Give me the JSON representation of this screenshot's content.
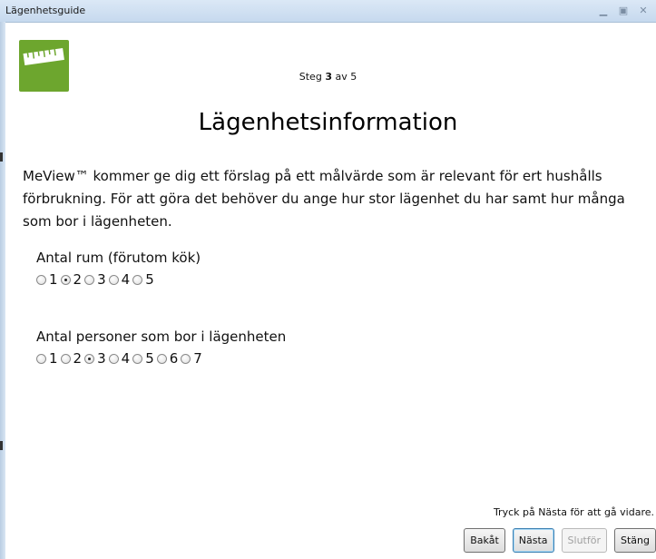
{
  "window": {
    "title": "Lägenhetsguide"
  },
  "step": {
    "prefix": "Steg ",
    "current": "3",
    "suffix": " av 5"
  },
  "heading": "Lägenhetsinformation",
  "intro": "MeView™ kommer ge dig ett förslag på ett målvärde som är relevant för ert hushålls förbrukning. För att göra det behöver du ange hur stor lägenhet du har samt hur många som bor i lägenheten.",
  "rooms": {
    "label": "Antal rum (förutom kök)",
    "options": [
      "1",
      "2",
      "3",
      "4",
      "5"
    ],
    "selected": "2"
  },
  "persons": {
    "label": "Antal personer som bor i lägenheten",
    "options": [
      "1",
      "2",
      "3",
      "4",
      "5",
      "6",
      "7"
    ],
    "selected": "3"
  },
  "hint": "Tryck på Nästa för att gå vidare.",
  "buttons": {
    "back": "Bakåt",
    "next": "Nästa",
    "finish": "Slutför",
    "close": "Stäng"
  },
  "colors": {
    "logo": "#6da62e",
    "titlebar": "#c6d9ee"
  }
}
